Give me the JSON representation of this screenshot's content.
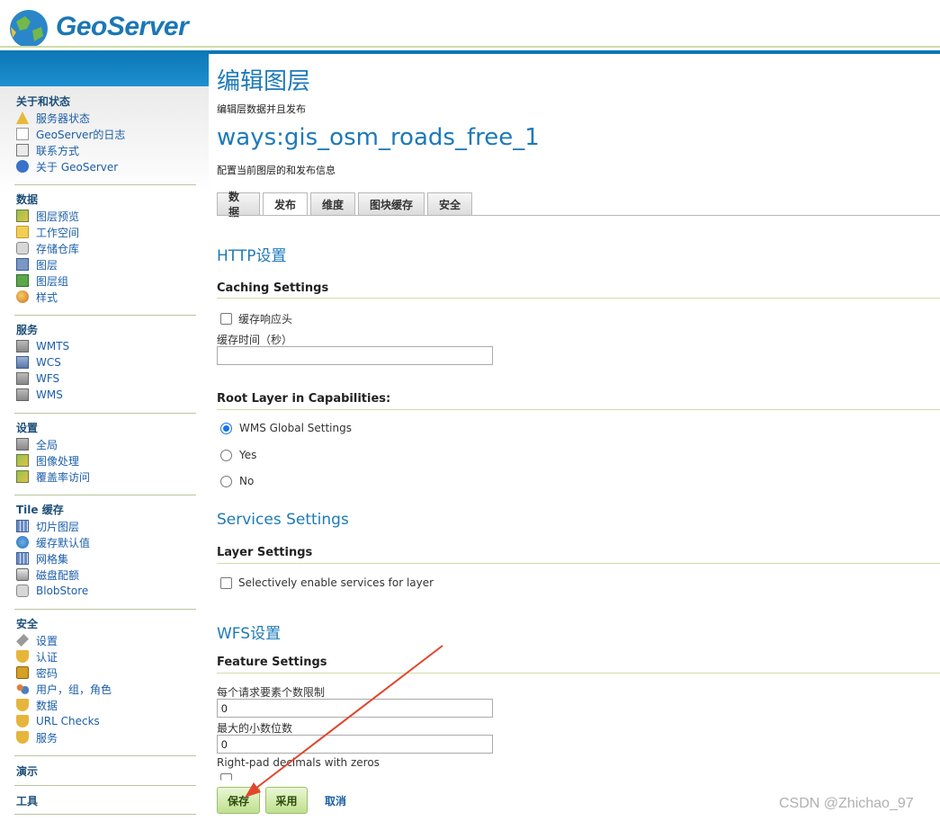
{
  "header": {
    "logo_text": "GeoServer"
  },
  "sidebar": {
    "sections": [
      {
        "title": "关于和状态",
        "items": [
          {
            "label": "服务器状态",
            "icon": "warning-icon"
          },
          {
            "label": "GeoServer的日志",
            "icon": "document-icon"
          },
          {
            "label": "联系方式",
            "icon": "contact-card-icon"
          },
          {
            "label": "关于 GeoServer",
            "icon": "help-icon"
          }
        ]
      },
      {
        "title": "数据",
        "items": [
          {
            "label": "图层预览",
            "icon": "map-icon"
          },
          {
            "label": "工作空间",
            "icon": "folder-icon"
          },
          {
            "label": "存储仓库",
            "icon": "database-icon"
          },
          {
            "label": "图层",
            "icon": "layer-icon"
          },
          {
            "label": "图层组",
            "icon": "layer-group-icon"
          },
          {
            "label": "样式",
            "icon": "style-icon"
          }
        ]
      },
      {
        "title": "服务",
        "items": [
          {
            "label": "WMTS",
            "icon": "server-icon"
          },
          {
            "label": "WCS",
            "icon": "server-icon"
          },
          {
            "label": "WFS",
            "icon": "server-icon"
          },
          {
            "label": "WMS",
            "icon": "server-icon"
          }
        ]
      },
      {
        "title": "设置",
        "items": [
          {
            "label": "全局",
            "icon": "server-icon"
          },
          {
            "label": "图像处理",
            "icon": "map-icon"
          },
          {
            "label": "覆盖率访问",
            "icon": "map-icon"
          }
        ]
      },
      {
        "title": "Tile 缓存",
        "items": [
          {
            "label": "切片图层",
            "icon": "grid-icon"
          },
          {
            "label": "缓存默认值",
            "icon": "globe-icon"
          },
          {
            "label": "网格集",
            "icon": "grid-icon"
          },
          {
            "label": "磁盘配额",
            "icon": "disk-icon"
          },
          {
            "label": "BlobStore",
            "icon": "database-icon"
          }
        ]
      },
      {
        "title": "安全",
        "items": [
          {
            "label": "设置",
            "icon": "key-icon"
          },
          {
            "label": "认证",
            "icon": "shield-icon"
          },
          {
            "label": "密码",
            "icon": "lock-icon"
          },
          {
            "label": "用户，组，角色",
            "icon": "users-icon"
          },
          {
            "label": "数据",
            "icon": "shield-icon"
          },
          {
            "label": "URL Checks",
            "icon": "shield-icon"
          },
          {
            "label": "服务",
            "icon": "shield-icon"
          }
        ]
      },
      {
        "title": "演示",
        "items": []
      },
      {
        "title": "工具",
        "items": []
      }
    ]
  },
  "page": {
    "title": "编辑图层",
    "subtitle": "编辑层数据并且发布",
    "layer_name": "ways:gis_osm_roads_free_1",
    "layer_desc": "配置当前图层的和发布信息"
  },
  "tabs": [
    {
      "label": "数据",
      "active": false
    },
    {
      "label": "发布",
      "active": true
    },
    {
      "label": "维度",
      "active": false
    },
    {
      "label": "图块缓存",
      "active": false
    },
    {
      "label": "安全",
      "active": false
    }
  ],
  "http": {
    "heading": "HTTP设置",
    "caching_title": "Caching Settings",
    "cache_headers_label": "缓存响应头",
    "cache_headers_checked": false,
    "cache_time_label": "缓存时间（秒）",
    "cache_time_value": "",
    "root_layer_title": "Root Layer in Capabilities:",
    "root_options": [
      "WMS Global Settings",
      "Yes",
      "No"
    ],
    "root_selected": "WMS Global Settings"
  },
  "services": {
    "heading": "Services Settings",
    "layer_settings_title": "Layer Settings",
    "selective_label": "Selectively enable services for layer",
    "selective_checked": false
  },
  "wfs": {
    "heading": "WFS设置",
    "feature_title": "Feature Settings",
    "max_features_label": "每个请求要素个数限制",
    "max_features_value": "0",
    "max_decimals_label": "最大的小数位数",
    "max_decimals_value": "0",
    "pad_label": "Right-pad decimals with zeros"
  },
  "buttons": {
    "save": "保存",
    "apply": "采用",
    "cancel": "取消"
  },
  "watermark": "CSDN @Zhichao_97",
  "colors": {
    "link": "#1b5ea8",
    "heading": "#1d7ab8",
    "banner": "#0c77b5",
    "button": "#bfe08e",
    "arrow": "#e0472d"
  }
}
